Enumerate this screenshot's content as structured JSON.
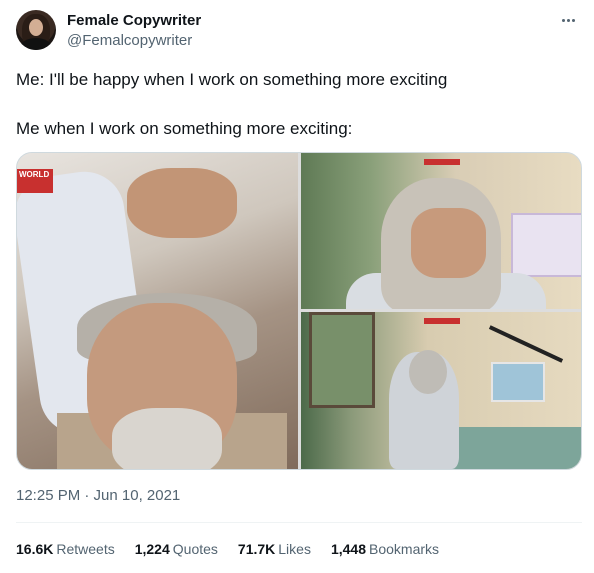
{
  "author": {
    "name": "Female Copywriter",
    "handle": "@Femalcopywriter"
  },
  "tweet": {
    "line1": "Me: I'll be happy when I work on something more exciting",
    "line2": "Me when I work on something more exciting:"
  },
  "media": {
    "count": 3,
    "logo_text": "WORLD"
  },
  "timestamp": "12:25 PM · Jun 10, 2021",
  "stats": {
    "retweets_value": "16.6K",
    "retweets_label": "Retweets",
    "quotes_value": "1,224",
    "quotes_label": "Quotes",
    "likes_value": "71.7K",
    "likes_label": "Likes",
    "bookmarks_value": "1,448",
    "bookmarks_label": "Bookmarks"
  },
  "icons": {
    "more": "more-horizontal-icon"
  }
}
